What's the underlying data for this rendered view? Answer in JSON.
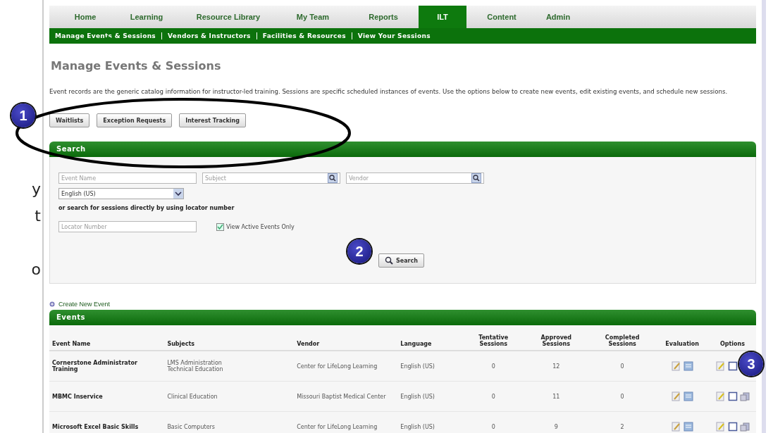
{
  "nav": {
    "tabs": [
      {
        "label": "Home",
        "selected": false
      },
      {
        "label": "Learning",
        "selected": false
      },
      {
        "label": "Resource Library",
        "selected": false
      },
      {
        "label": "My Team",
        "selected": false
      },
      {
        "label": "Reports",
        "selected": false
      },
      {
        "label": "ILT",
        "selected": true
      },
      {
        "label": "Content",
        "selected": false
      },
      {
        "label": "Admin",
        "selected": false
      }
    ]
  },
  "subnav": {
    "links": [
      {
        "label": "Manage Events & Sessions",
        "selected": true
      },
      {
        "label": "Vendors & Instructors",
        "selected": false
      },
      {
        "label": "Facilities & Resources",
        "selected": false
      },
      {
        "label": "View Your Sessions",
        "selected": false
      }
    ]
  },
  "page_title": "Manage Events & Sessions",
  "description": "Event records are the generic catalog information for instructor-led training. Sessions are specific scheduled instances of events. Use the options below to create new events, edit existing events, and schedule new sessions.",
  "action_buttons": [
    "Waitlists",
    "Exception Requests",
    "Interest Tracking"
  ],
  "search": {
    "title": "Search",
    "fields": [
      {
        "placeholder": "Event Name",
        "kind": "text"
      },
      {
        "placeholder": "Subject",
        "kind": "lookup"
      },
      {
        "placeholder": "Vendor",
        "kind": "lookup"
      }
    ],
    "language_select": {
      "value": "English (US)"
    },
    "locator_label": "or search for sessions directly by using locator number",
    "locator": {
      "placeholder": "Locator Number"
    },
    "active_only": {
      "label": "View Active Events Only",
      "checked": true
    },
    "button": "Search"
  },
  "create_link": "Create New Event",
  "events": {
    "title": "Events",
    "columns": [
      "Event Name",
      "Subjects",
      "Vendor",
      "Language",
      "Tentative Sessions",
      "Approved Sessions",
      "Completed Sessions",
      "Evaluation",
      "Options"
    ],
    "rows": [
      {
        "event_name": "Cornerstone Administrator Training",
        "subjects": [
          "LMS Administration",
          "Technical Education"
        ],
        "vendor": "Center for LifeLong Learning",
        "language": "English (US)",
        "tentative": "0",
        "approved": "12",
        "completed": "0"
      },
      {
        "event_name": "MBMC Inservice",
        "subjects": [
          "Clinical Education"
        ],
        "vendor": "Missouri Baptist Medical Center",
        "language": "English (US)",
        "tentative": "0",
        "approved": "11",
        "completed": "0"
      },
      {
        "event_name": "Microsoft Excel Basic Skills",
        "subjects": [
          "Basic Computers"
        ],
        "vendor": "Center for LifeLong Learning",
        "language": "English (US)",
        "tentative": "0",
        "approved": "9",
        "completed": "2"
      }
    ]
  },
  "annotations": [
    {
      "number": "1"
    },
    {
      "number": "2"
    },
    {
      "number": "3"
    }
  ],
  "margin_fragments": [
    "y",
    "t",
    "o"
  ]
}
